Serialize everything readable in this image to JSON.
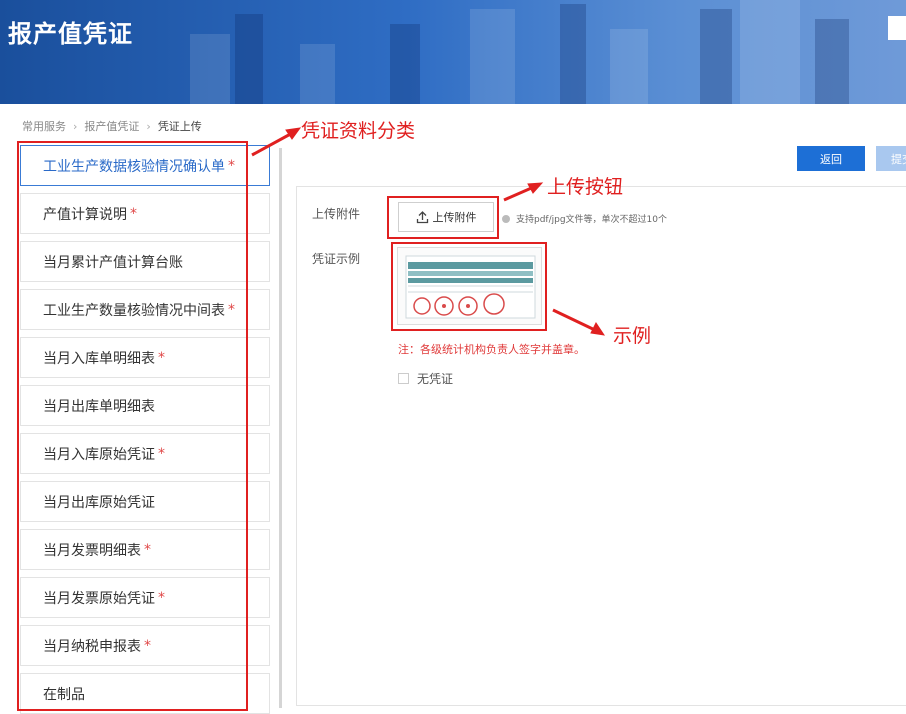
{
  "header": {
    "title": "报产值凭证"
  },
  "breadcrumb": {
    "items": [
      "常用服务",
      "报产值凭证"
    ],
    "current": "凭证上传"
  },
  "categories": [
    {
      "label": "工业生产数据核验情况确认单",
      "required": "*"
    },
    {
      "label": "产值计算说明",
      "required": "*"
    },
    {
      "label": "当月累计产值计算台账",
      "required": ""
    },
    {
      "label": "工业生产数量核验情况中间表",
      "required": "*"
    },
    {
      "label": "当月入库单明细表",
      "required": "*"
    },
    {
      "label": "当月出库单明细表",
      "required": ""
    },
    {
      "label": "当月入库原始凭证",
      "required": "*"
    },
    {
      "label": "当月出库原始凭证",
      "required": ""
    },
    {
      "label": "当月发票明细表",
      "required": "*"
    },
    {
      "label": "当月发票原始凭证",
      "required": "*"
    },
    {
      "label": "当月纳税申报表",
      "required": "*"
    },
    {
      "label": "在制品",
      "required": ""
    }
  ],
  "actions": {
    "back": "返回",
    "submit": "提交"
  },
  "upload": {
    "label": "上传附件",
    "button": "上传附件",
    "hint": "支持pdf/jpg文件等，单次不超过10个"
  },
  "sample": {
    "label": "凭证示例",
    "note": "注：各级统计机构负责人签字并盖章。"
  },
  "no_certificate": "无凭证",
  "annotations": {
    "category": "凭证资料分类",
    "upload_button": "上传按钮",
    "sample": "示例"
  },
  "colors": {
    "accent": "#1d6fd6",
    "annotation": "#e02020",
    "required": "#e04848"
  }
}
